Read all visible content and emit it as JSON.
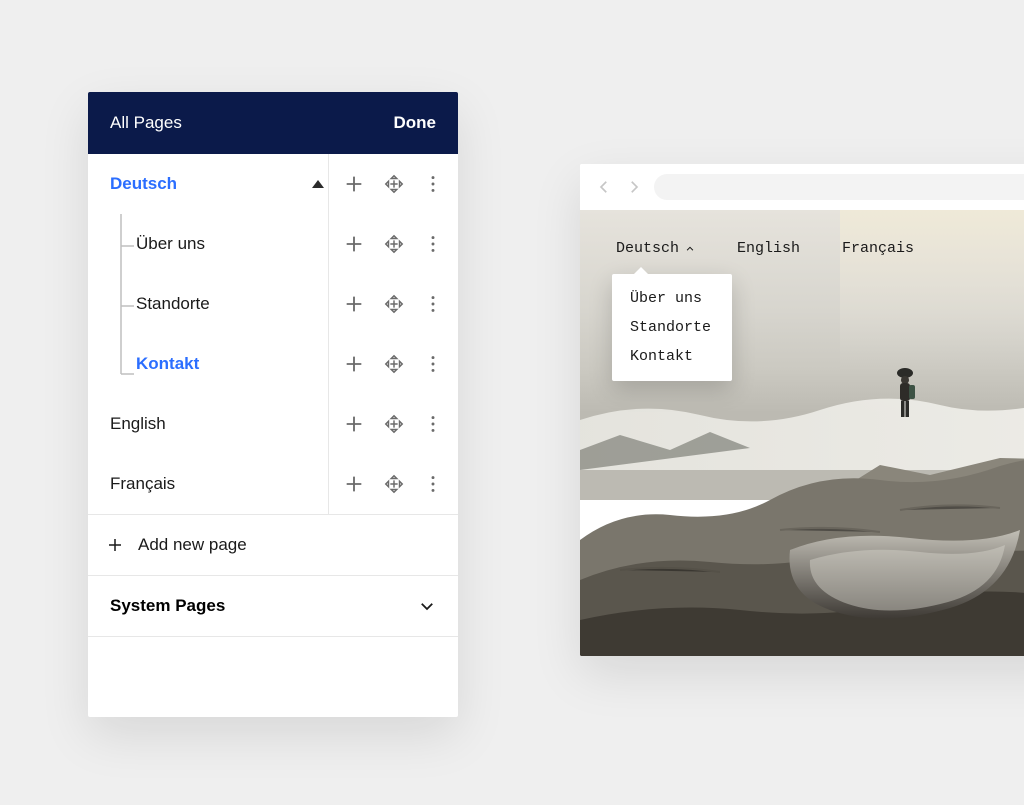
{
  "panel": {
    "title": "All Pages",
    "done_label": "Done",
    "add_label": "Add new page",
    "system_label": "System Pages",
    "root": {
      "label": "Deutsch",
      "expanded": true,
      "children": [
        {
          "label": "Über uns"
        },
        {
          "label": "Standorte"
        },
        {
          "label": "Kontakt",
          "active": true
        }
      ]
    },
    "siblings": [
      {
        "label": "English"
      },
      {
        "label": "Français"
      }
    ]
  },
  "browser": {
    "nav": [
      "Deutsch",
      "English",
      "Français"
    ],
    "dropdown": [
      "Über uns",
      "Standorte",
      "Kontakt"
    ]
  },
  "colors": {
    "accent": "#2b6eff",
    "header_bg": "#0b1a4a"
  }
}
